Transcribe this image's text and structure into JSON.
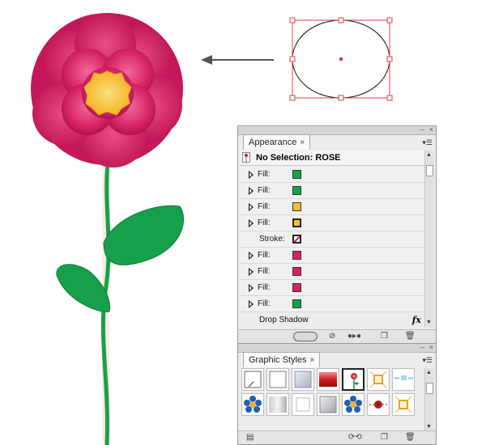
{
  "canvas": {
    "arrow_color": "#555555",
    "selection_color": "#d94040"
  },
  "appearance": {
    "tab_label": "Appearance",
    "close_glyph": "×",
    "selection_label": "No Selection: ROSE",
    "rows": [
      {
        "label": "Fill:",
        "kind": "fill",
        "color": "#16a24a"
      },
      {
        "label": "Fill:",
        "kind": "fill",
        "color": "#16a24a"
      },
      {
        "label": "Fill:",
        "kind": "fill",
        "color": "#f2c030"
      },
      {
        "label": "Fill:",
        "kind": "fill-outline",
        "color": "#f5c230"
      },
      {
        "label": "Stroke:",
        "kind": "stroke",
        "color": "none"
      },
      {
        "label": "Fill:",
        "kind": "fill",
        "color": "#d9205f"
      },
      {
        "label": "Fill:",
        "kind": "fill",
        "color": "#d9205f"
      },
      {
        "label": "Fill:",
        "kind": "fill",
        "color": "#d9205f"
      },
      {
        "label": "Fill:",
        "kind": "fill",
        "color": "#16a24a"
      }
    ],
    "drop_shadow_label": "Drop Shadow",
    "fx_label": "fx"
  },
  "graphic_styles": {
    "tab_label": "Graphic Styles",
    "close_glyph": "×",
    "swatches": [
      {
        "name": "default-none",
        "kind": "none"
      },
      {
        "name": "plain-white",
        "kind": "white"
      },
      {
        "name": "silver-gradient",
        "kind": "silver"
      },
      {
        "name": "red-gloss",
        "kind": "red"
      },
      {
        "name": "rose-style",
        "kind": "rose",
        "selected": true
      },
      {
        "name": "orange-burst",
        "kind": "burst"
      },
      {
        "name": "blue-dashes",
        "kind": "dashes"
      },
      {
        "name": "blue-flower",
        "kind": "flower"
      },
      {
        "name": "gray-gradient",
        "kind": "gray"
      },
      {
        "name": "white-square",
        "kind": "whitesq"
      },
      {
        "name": "gray-square",
        "kind": "graysq"
      },
      {
        "name": "blue-flower-2",
        "kind": "flower"
      },
      {
        "name": "ladybug",
        "kind": "bug"
      },
      {
        "name": "orange-burst-2",
        "kind": "burst"
      }
    ]
  }
}
